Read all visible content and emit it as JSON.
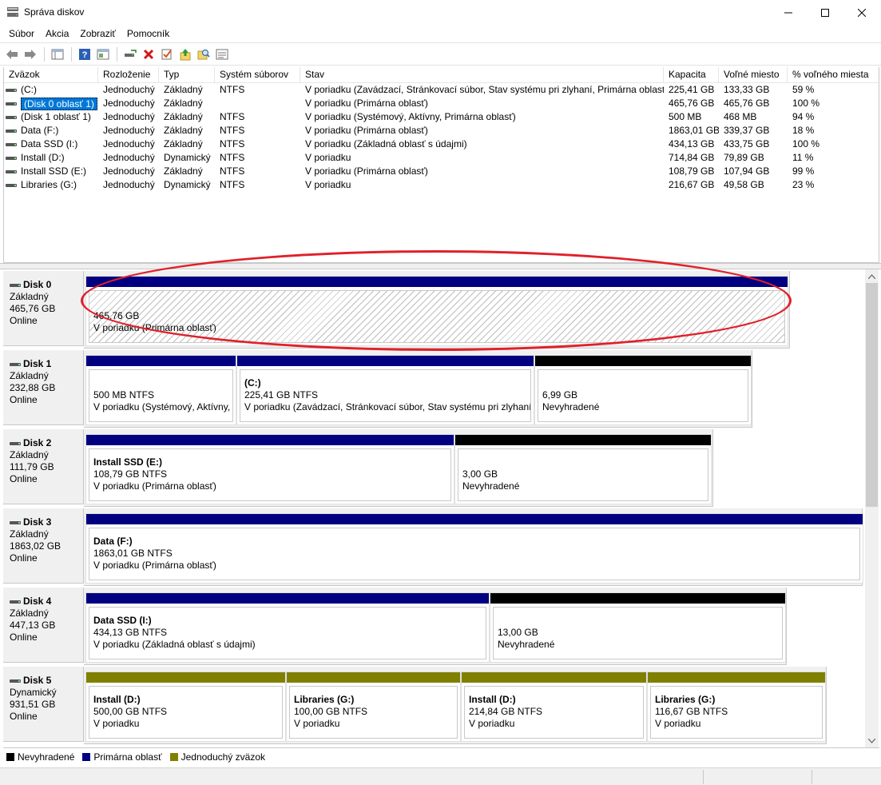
{
  "window": {
    "title": "Správa diskov",
    "minimize_icon": "minimize-icon",
    "maximize_icon": "maximize-icon",
    "close_icon": "close-icon"
  },
  "menu": [
    "Súbor",
    "Akcia",
    "Zobraziť",
    "Pomocník"
  ],
  "toolbar_icons": [
    "back-arrow-icon",
    "forward-arrow-icon",
    "properties-pane-icon",
    "help-icon",
    "console-tree-icon",
    "connect-disk-icon",
    "delete-icon",
    "check-icon",
    "up-level-icon",
    "search-icon",
    "details-icon"
  ],
  "volume_list": {
    "columns": [
      "Zväzok",
      "Rozloženie",
      "Typ",
      "Systém súborov",
      "Stav",
      "Kapacita",
      "Voľné miesto",
      "% voľného miesta"
    ],
    "selected_index": 1,
    "rows": [
      [
        "(C:)",
        "Jednoduchý",
        "Základný",
        "NTFS",
        "V poriadku (Zavádzací, Stránkovací súbor, Stav systému pri zlyhaní, Primárna oblasť)",
        "225,41 GB",
        "133,33 GB",
        "59 %"
      ],
      [
        "(Disk 0 oblasť 1)",
        "Jednoduchý",
        "Základný",
        "",
        "V poriadku (Primárna oblasť)",
        "465,76 GB",
        "465,76 GB",
        "100 %"
      ],
      [
        "(Disk 1 oblasť 1)",
        "Jednoduchý",
        "Základný",
        "NTFS",
        "V poriadku (Systémový, Aktívny, Primárna oblasť)",
        "500 MB",
        "468 MB",
        "94 %"
      ],
      [
        "Data (F:)",
        "Jednoduchý",
        "Základný",
        "NTFS",
        "V poriadku (Primárna oblasť)",
        "1863,01 GB",
        "339,37 GB",
        "18 %"
      ],
      [
        "Data SSD (I:)",
        "Jednoduchý",
        "Základný",
        "NTFS",
        "V poriadku (Základná oblasť s údajmi)",
        "434,13 GB",
        "433,75 GB",
        "100 %"
      ],
      [
        "Install (D:)",
        "Jednoduchý",
        "Dynamický",
        "NTFS",
        "V poriadku",
        "714,84 GB",
        "79,89 GB",
        "11 %"
      ],
      [
        "Install SSD (E:)",
        "Jednoduchý",
        "Základný",
        "NTFS",
        "V poriadku (Primárna oblasť)",
        "108,79 GB",
        "107,94 GB",
        "99 %"
      ],
      [
        "Libraries (G:)",
        "Jednoduchý",
        "Dynamický",
        "NTFS",
        "V poriadku",
        "216,67 GB",
        "49,58 GB",
        "23 %"
      ]
    ]
  },
  "disks": [
    {
      "name": "Disk 0",
      "type": "Základný",
      "size": "465,76 GB",
      "status": "Online",
      "partitions": [
        {
          "bar": "primary",
          "label": "",
          "size": "465,76 GB",
          "status": "V poriadku (Primárna oblasť)",
          "hatched": true
        }
      ]
    },
    {
      "name": "Disk 1",
      "type": "Základný",
      "size": "232,88 GB",
      "status": "Online",
      "partitions": [
        {
          "bar": "primary",
          "label": "",
          "size": "500 MB NTFS",
          "status": "V poriadku (Systémový, Aktívny,"
        },
        {
          "bar": "primary",
          "label": "(C:)",
          "size": "225,41 GB NTFS",
          "status": "V poriadku (Zavádzací, Stránkovací súbor, Stav systému pri zlyhaní, P"
        },
        {
          "bar": "unalloc",
          "label": "",
          "size": "6,99 GB",
          "status": "Nevyhradené"
        }
      ]
    },
    {
      "name": "Disk 2",
      "type": "Základný",
      "size": "111,79 GB",
      "status": "Online",
      "partitions": [
        {
          "bar": "primary",
          "label": "Install SSD  (E:)",
          "size": "108,79 GB NTFS",
          "status": "V poriadku (Primárna oblasť)"
        },
        {
          "bar": "unalloc",
          "label": "",
          "size": "3,00 GB",
          "status": "Nevyhradené"
        }
      ]
    },
    {
      "name": "Disk 3",
      "type": "Základný",
      "size": "1863,02 GB",
      "status": "Online",
      "partitions": [
        {
          "bar": "primary",
          "label": "Data  (F:)",
          "size": "1863,01 GB NTFS",
          "status": "V poriadku (Primárna oblasť)"
        }
      ]
    },
    {
      "name": "Disk 4",
      "type": "Základný",
      "size": "447,13 GB",
      "status": "Online",
      "partitions": [
        {
          "bar": "primary",
          "label": "Data SSD  (I:)",
          "size": "434,13 GB NTFS",
          "status": "V poriadku (Základná oblasť s údajmi)"
        },
        {
          "bar": "unalloc",
          "label": "",
          "size": "13,00 GB",
          "status": "Nevyhradené"
        }
      ]
    },
    {
      "name": "Disk 5",
      "type": "Dynamický",
      "size": "931,51 GB",
      "status": "Online",
      "partitions": [
        {
          "bar": "simple",
          "label": "Install  (D:)",
          "size": "500,00 GB NTFS",
          "status": "V poriadku"
        },
        {
          "bar": "simple",
          "label": "Libraries  (G:)",
          "size": "100,00 GB NTFS",
          "status": "V poriadku"
        },
        {
          "bar": "simple",
          "label": "Install  (D:)",
          "size": "214,84 GB NTFS",
          "status": "V poriadku"
        },
        {
          "bar": "simple",
          "label": "Libraries  (G:)",
          "size": "116,67 GB NTFS",
          "status": "V poriadku"
        }
      ]
    }
  ],
  "legend": [
    {
      "label": "Nevyhradené",
      "color": "#000000"
    },
    {
      "label": "Primárna oblasť",
      "color": "#000080"
    },
    {
      "label": "Jednoduchý zväzok",
      "color": "#808000"
    }
  ],
  "colors": {
    "highlight": "#e0202a",
    "selection": "#0078d7"
  }
}
